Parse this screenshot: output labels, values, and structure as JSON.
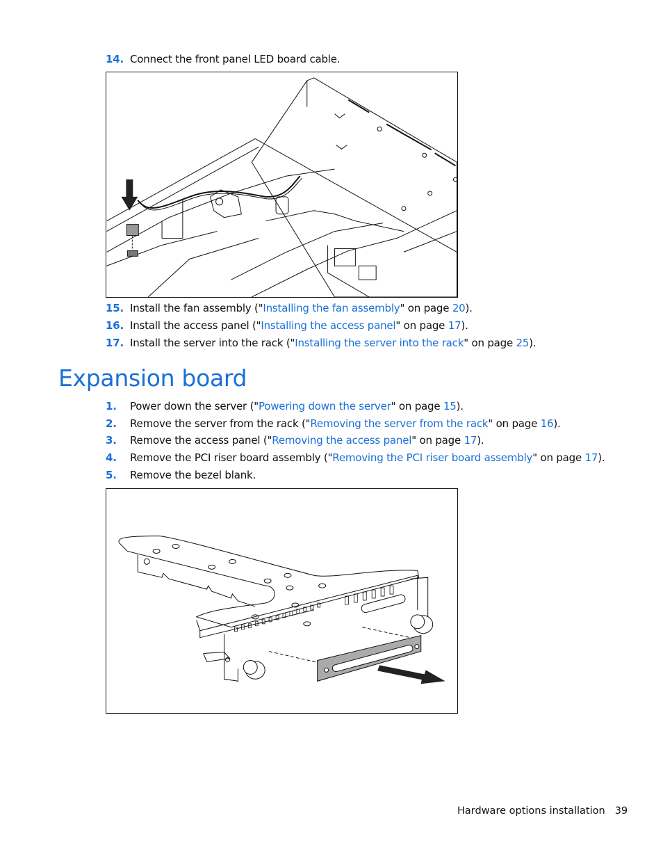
{
  "steps_top": [
    {
      "num": "14.",
      "text_before": "Connect the front panel LED board cable.",
      "link": "",
      "text_mid": "",
      "page": "",
      "text_after": ""
    },
    {
      "num": "15.",
      "text_before": "Install the fan assembly (\"",
      "link": "Installing the fan assembly",
      "text_mid": "\" on page ",
      "page": "20",
      "text_after": ")."
    },
    {
      "num": "16.",
      "text_before": "Install the access panel (\"",
      "link": "Installing the access panel",
      "text_mid": "\" on page ",
      "page": "17",
      "text_after": ")."
    },
    {
      "num": "17.",
      "text_before": "Install the server into the rack (\"",
      "link": "Installing the server into the rack",
      "text_mid": "\" on page ",
      "page": "25",
      "text_after": ")."
    }
  ],
  "section": {
    "title": "Expansion board"
  },
  "steps_section": [
    {
      "num": "1.",
      "text_before": "Power down the server (\"",
      "link": "Powering down the server",
      "text_mid": "\" on page ",
      "page": "15",
      "text_after": ")."
    },
    {
      "num": "2.",
      "text_before": "Remove the server from the rack (\"",
      "link": "Removing the server from the rack",
      "text_mid": "\" on page ",
      "page": "16",
      "text_after": ")."
    },
    {
      "num": "3.",
      "text_before": "Remove the access panel (\"",
      "link": "Removing the access panel",
      "text_mid": "\" on page ",
      "page": "17",
      "text_after": ")."
    },
    {
      "num": "4.",
      "text_before": "Remove the PCI riser board assembly (\"",
      "link": "Removing the PCI riser board assembly",
      "text_mid": "\" on page ",
      "page": "17",
      "text_after": ")."
    },
    {
      "num": "5.",
      "text_before": "Remove the bezel blank.",
      "link": "",
      "text_mid": "",
      "page": "",
      "text_after": ""
    }
  ],
  "figures": {
    "fig1": "Front panel LED board cable connection illustration",
    "fig2": "Bezel blank removal from PCI riser cage illustration"
  },
  "footer": {
    "section": "Hardware options installation",
    "page": "39"
  },
  "colors": {
    "accent": "#1a6fd6",
    "text": "#111111"
  }
}
